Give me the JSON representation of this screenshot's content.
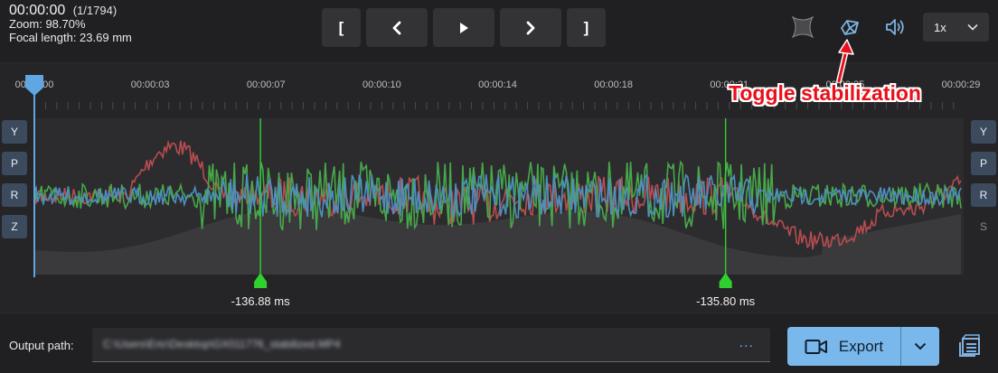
{
  "info": {
    "timecode": "00:00:00",
    "frame_count": "(1/1794)",
    "zoom": "Zoom: 98.70%",
    "focal_length": "Focal length: 23.69 mm"
  },
  "transport": {
    "mark_in_label": "[",
    "mark_out_label": "]",
    "prev_icon": "chevron-left-icon",
    "play_icon": "play-icon",
    "next_icon": "chevron-right-icon"
  },
  "right_controls": {
    "lens_icon": "lens-distortion-icon",
    "stabilization_icon": "stabilization-icon",
    "volume_icon": "speaker-icon",
    "speed_value": "1x"
  },
  "timeline": {
    "ticks": [
      "00:00:00",
      "00:00:03",
      "00:00:07",
      "00:00:10",
      "00:00:14",
      "00:00:18",
      "00:00:21",
      "00:00:25",
      "00:00:29"
    ],
    "playhead_fraction": 0.0,
    "left_axes": [
      "Y",
      "P",
      "R",
      "Z"
    ],
    "right_axes": [
      "Y",
      "P",
      "R",
      "S"
    ],
    "sync_points": [
      {
        "label": "-136.88 ms",
        "time_fraction": 0.244
      },
      {
        "label": "-135.80 ms",
        "time_fraction": 0.746
      }
    ],
    "series_colors": {
      "yaw": "#b84c50",
      "pitch": "#47a84a",
      "roll": "#4e8fc0",
      "zoom": "#3a3a3c"
    }
  },
  "annotation": {
    "text": "Toggle stabilization",
    "color": "#e8101b"
  },
  "output": {
    "label": "Output path:",
    "path_value": "C:\\Users\\Eric\\Desktop\\GX011776_stabilized.MP4",
    "browse_label": "...",
    "export_label": "Export"
  },
  "colors": {
    "accent": "#7ab8ec",
    "sync_marker": "#2fd12f",
    "playhead": "#5fa6e3"
  }
}
